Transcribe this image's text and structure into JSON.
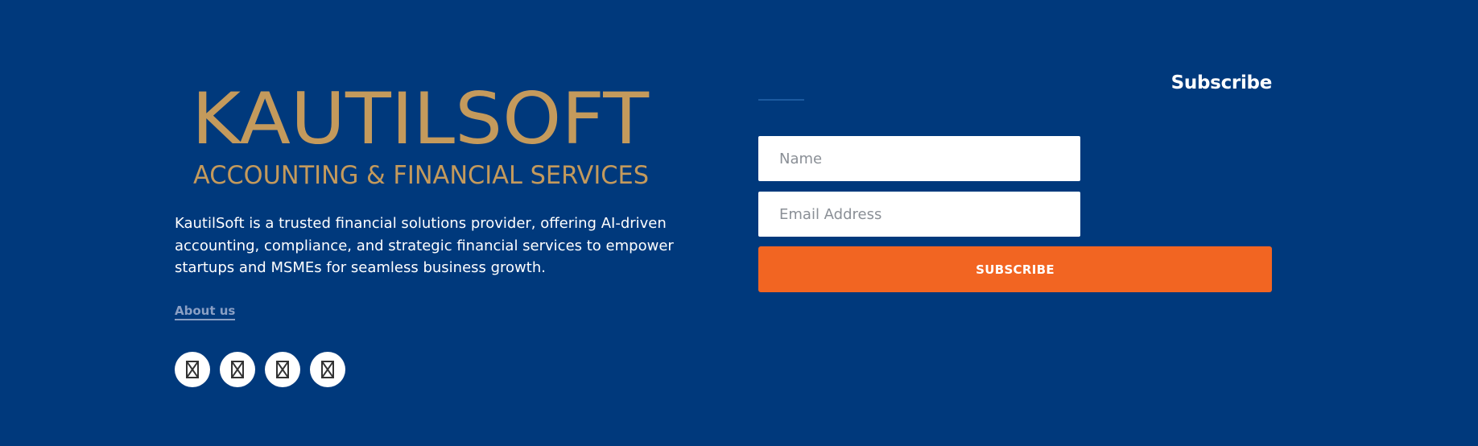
{
  "brand": {
    "logo_main": "KAUTILSOFT",
    "logo_tagline": "ACCOUNTING & FINANCIAL SERVICES",
    "logo_color": "#c49a5c"
  },
  "about": {
    "description": "KautilSoft is a trusted financial solutions provider, offering AI-driven accounting, compliance, and strategic financial services to empower startups and MSMEs for seamless business growth.",
    "link_label": "About us"
  },
  "social": {
    "icons": [
      "social-icon-1",
      "social-icon-2",
      "social-icon-3",
      "social-icon-4"
    ]
  },
  "subscribe": {
    "heading": "Subscribe",
    "name_placeholder": "Name",
    "email_placeholder": "Email Address",
    "button_label": "SUBSCRIBE",
    "button_color": "#f26522"
  },
  "colors": {
    "background": "#00397c",
    "link": "#8a9fc4"
  }
}
